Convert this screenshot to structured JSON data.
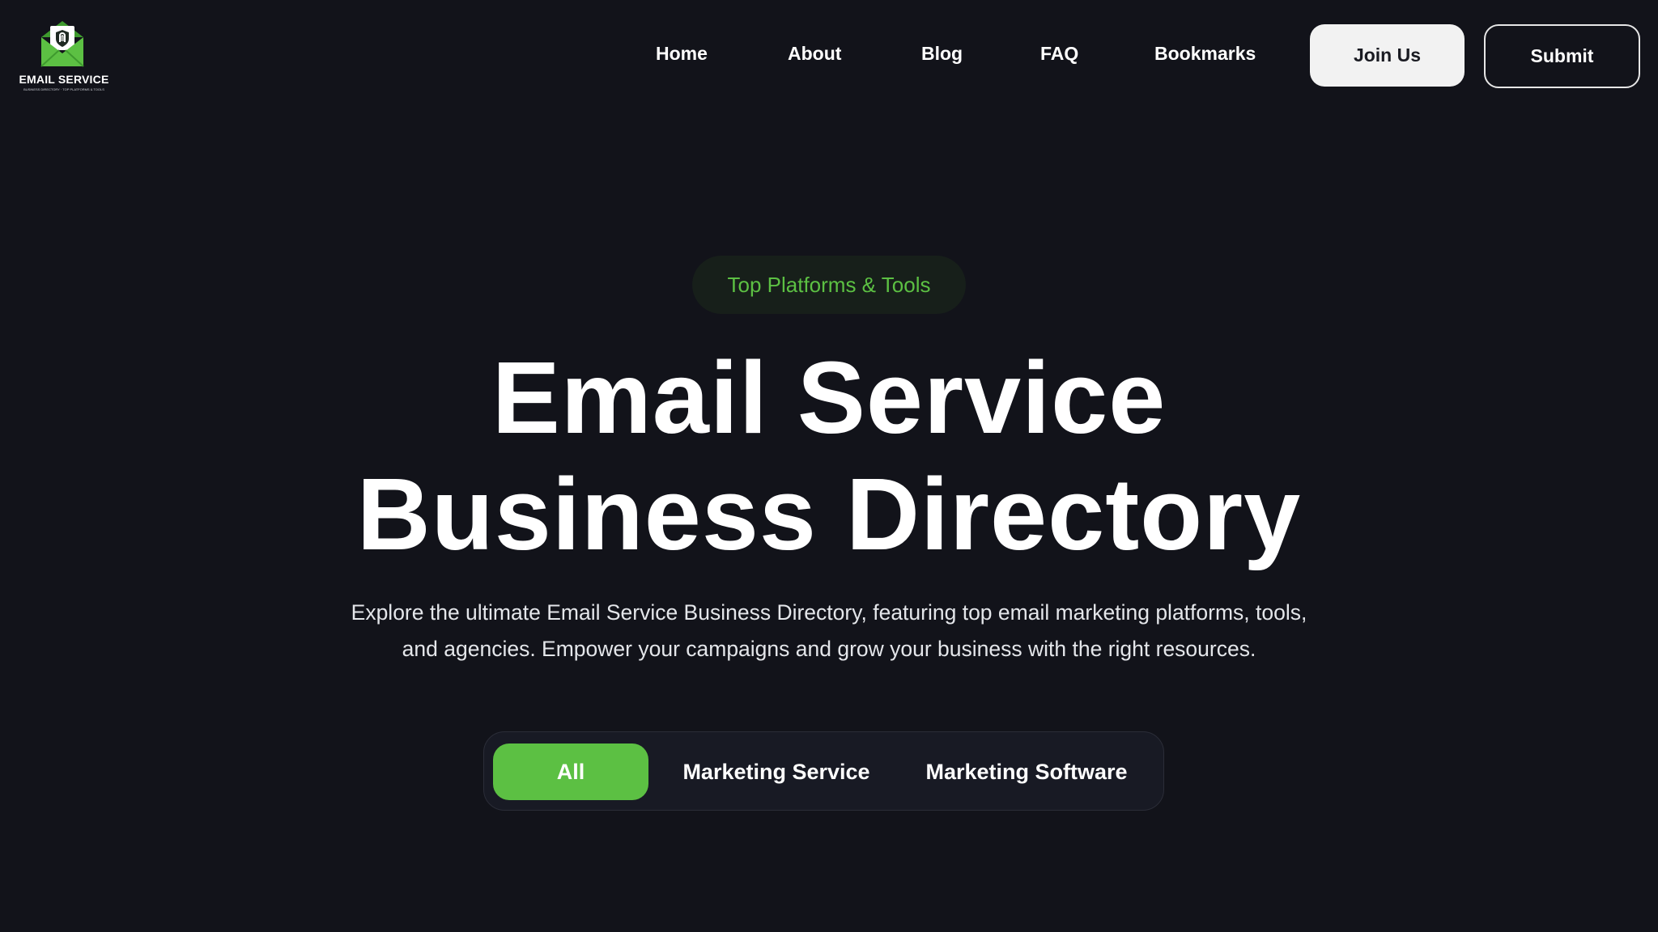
{
  "header": {
    "logo": {
      "title": "EMAIL SERVICE",
      "subtitle": "BUSINESS DIRECTORY · TOP PLATFORMS & TOOLS",
      "icon": "envelope-shield-icon",
      "accent": "#5cc043"
    },
    "nav": [
      {
        "label": "Home"
      },
      {
        "label": "About"
      },
      {
        "label": "Blog"
      },
      {
        "label": "FAQ"
      },
      {
        "label": "Bookmarks"
      }
    ],
    "join_label": "Join Us",
    "submit_label": "Submit"
  },
  "hero": {
    "badge": "Top Platforms & Tools",
    "title_line1": "Email Service",
    "title_line2": "Business Directory",
    "description": "Explore the ultimate Email Service Business Directory, featuring top email marketing platforms, tools, and agencies. Empower your campaigns and grow your business with the right resources."
  },
  "filters": {
    "tabs": [
      {
        "label": "All",
        "active": true
      },
      {
        "label": "Marketing Service",
        "active": false
      },
      {
        "label": "Marketing Software",
        "active": false
      }
    ]
  },
  "colors": {
    "background": "#12131a",
    "accent": "#5cc043",
    "text": "#ffffff"
  }
}
